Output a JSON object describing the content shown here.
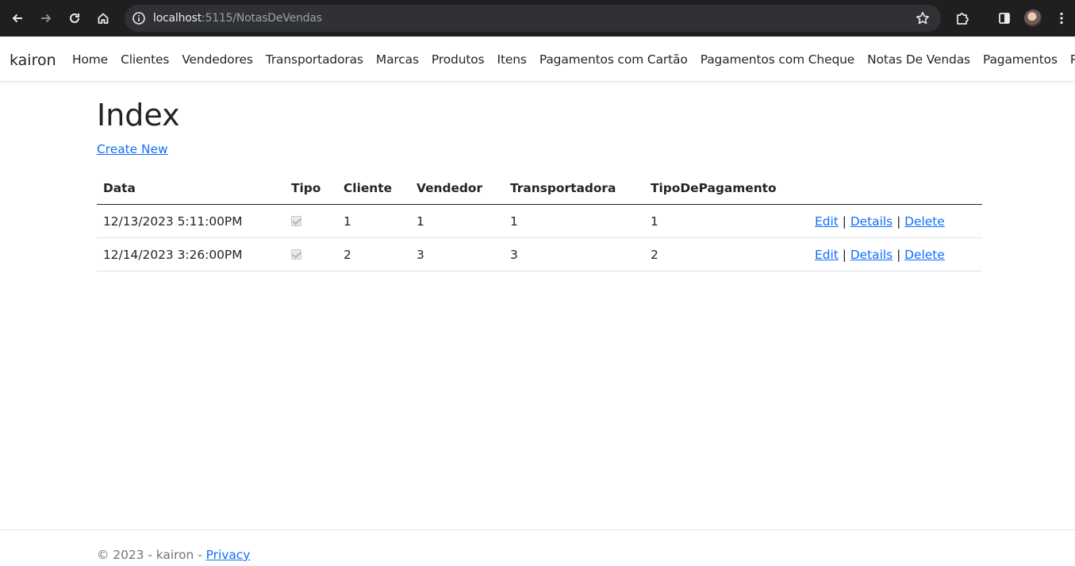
{
  "browser": {
    "url_host": "localhost",
    "url_path": ":5115/NotasDeVendas"
  },
  "navbar": {
    "brand": "kairon",
    "links": [
      "Home",
      "Clientes",
      "Vendedores",
      "Transportadoras",
      "Marcas",
      "Produtos",
      "Itens",
      "Pagamentos com Cartão",
      "Pagamentos com Cheque",
      "Notas De Vendas",
      "Pagamentos",
      "Privacy"
    ]
  },
  "page": {
    "title": "Index",
    "create_link": "Create New"
  },
  "table": {
    "headers": [
      "Data",
      "Tipo",
      "Cliente",
      "Vendedor",
      "Transportadora",
      "TipoDePagamento"
    ],
    "rows": [
      {
        "data": "12/13/2023 5:11:00PM",
        "tipo_checked": true,
        "cliente": "1",
        "vendedor": "1",
        "transportadora": "1",
        "tipo_pagamento": "1"
      },
      {
        "data": "12/14/2023 3:26:00PM",
        "tipo_checked": true,
        "cliente": "2",
        "vendedor": "3",
        "transportadora": "3",
        "tipo_pagamento": "2"
      }
    ],
    "actions": {
      "edit": "Edit",
      "separator": "|",
      "details": "Details",
      "delete": "Delete"
    }
  },
  "footer": {
    "text": "© 2023 - kairon - ",
    "link": "Privacy"
  },
  "colors": {
    "link": "#0d6efd",
    "chrome_bg": "#1f1f1f",
    "omnibox_bg": "#303134"
  }
}
